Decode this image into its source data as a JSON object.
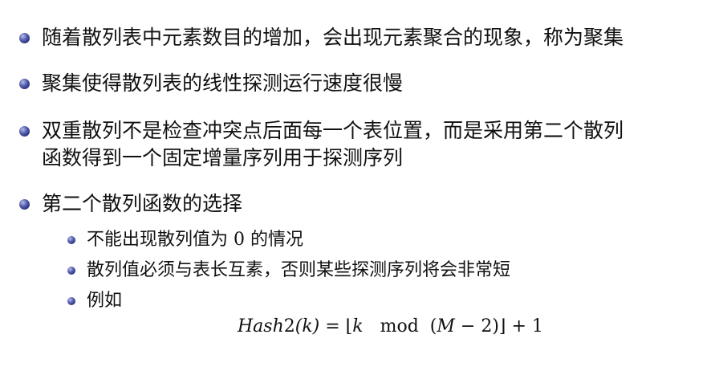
{
  "bullets": [
    {
      "text": "随着散列表中元素数目的增加，会出现元素聚合的现象，称为聚集"
    },
    {
      "text": "聚集使得散列表的线性探测运行速度很慢"
    },
    {
      "line1": "双重散列不是检查冲突点后面每一个表位置，而是采用第二个散列",
      "line2": "函数得到一个固定增量序列用于探测序列"
    },
    {
      "text": "第二个散列函数的选择"
    }
  ],
  "subbullets": [
    {
      "before": "不能出现散列值为 ",
      "value": "0",
      "after": " 的情况"
    },
    {
      "text": "散列值必须与表长互素，否则某些探测序列将会非常短"
    },
    {
      "text": "例如"
    }
  ],
  "formula": {
    "lhs_func": "Hash",
    "lhs_num": "2",
    "lhs_arg": "(k)",
    "eq": " = ⌊",
    "k": "k",
    "mod": "   mod  (",
    "m": "M",
    "rest": " − 2)⌋ + 1"
  },
  "colors": {
    "bullet": "#2a2f7a",
    "text": "#111111"
  }
}
